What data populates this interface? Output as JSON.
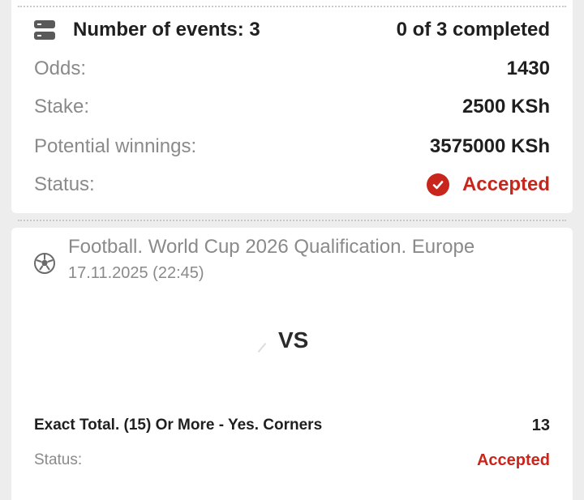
{
  "summary": {
    "events_label": "Number of events: 3",
    "completed": "0 of 3 completed",
    "odds_label": "Odds:",
    "odds_value": "1430",
    "stake_label": "Stake:",
    "stake_value": "2500 KSh",
    "winnings_label": "Potential winnings:",
    "winnings_value": "3575000 KSh",
    "status_label": "Status:",
    "status_value": "Accepted"
  },
  "event": {
    "title": "Football. World Cup 2026 Qualification. Europe",
    "datetime": "17.11.2025 (22:45)",
    "vs": "VS",
    "market": "Exact Total. (15) Or More - Yes. Corners",
    "market_odds": "13",
    "status_label": "Status:",
    "status_value": "Accepted"
  },
  "colors": {
    "accent": "#c8261c",
    "background": "#ededed",
    "card": "#ffffff"
  },
  "icons": {
    "events": "events-list-icon",
    "status": "check-circle-icon",
    "sport": "football-icon"
  }
}
